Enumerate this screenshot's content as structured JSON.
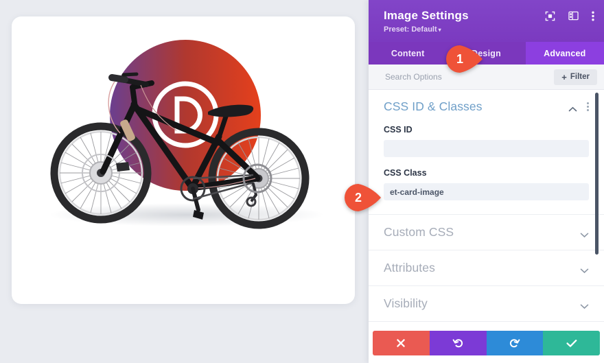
{
  "preview": {
    "alt": "Black hybrid bicycle on white card with gradient circle Divi D logo",
    "logo_letter": "D",
    "gradient_start": "#6b3f8f",
    "gradient_end": "#e5401c",
    "card_background": "#ffffff",
    "canvas_background": "#e9ebf0"
  },
  "panel": {
    "title": "Image Settings",
    "preset_label": "Preset: Default",
    "preset_caret": "▾",
    "header_color": "#7b3ac0",
    "header_icons": [
      {
        "name": "focus-icon",
        "label": "Focus Mode"
      },
      {
        "name": "layout-columns-icon",
        "label": "Layout"
      },
      {
        "name": "kebab-menu-icon",
        "label": "More Options"
      }
    ],
    "tabs": [
      {
        "label": "Content",
        "active": false
      },
      {
        "label": "Design",
        "active": false
      },
      {
        "label": "Advanced",
        "active": true
      }
    ],
    "active_tab_color": "#8c3fe0",
    "search": {
      "placeholder": "Search Options",
      "value": ""
    },
    "filter_button": {
      "plus": "+",
      "label": "Filter"
    },
    "sections": [
      {
        "title": "CSS ID & Classes",
        "open": true,
        "title_color": "#6f9fc8",
        "fields": [
          {
            "label": "CSS ID",
            "value": "",
            "placeholder": ""
          },
          {
            "label": "CSS Class",
            "value": "et-card-image",
            "placeholder": ""
          }
        ]
      },
      {
        "title": "Custom CSS",
        "open": false,
        "title_color": "#a6acb8"
      },
      {
        "title": "Attributes",
        "open": false,
        "title_color": "#a6acb8"
      },
      {
        "title": "Visibility",
        "open": false,
        "title_color": "#a6acb8"
      }
    ],
    "footer_buttons": [
      {
        "name": "cancel-button",
        "icon": "close-icon",
        "color": "#ea5a52",
        "label": "Cancel"
      },
      {
        "name": "undo-button",
        "icon": "undo-icon",
        "color": "#7c3ad6",
        "label": "Undo"
      },
      {
        "name": "redo-button",
        "icon": "redo-icon",
        "color": "#2d8bd8",
        "label": "Redo"
      },
      {
        "name": "save-button",
        "icon": "check-icon",
        "color": "#2eb898",
        "label": "Save Changes"
      }
    ]
  },
  "annotations": {
    "marker_color": "#ef5238",
    "steps": [
      {
        "number": "1",
        "target": "advanced-tab"
      },
      {
        "number": "2",
        "target": "css-class-field"
      }
    ]
  }
}
